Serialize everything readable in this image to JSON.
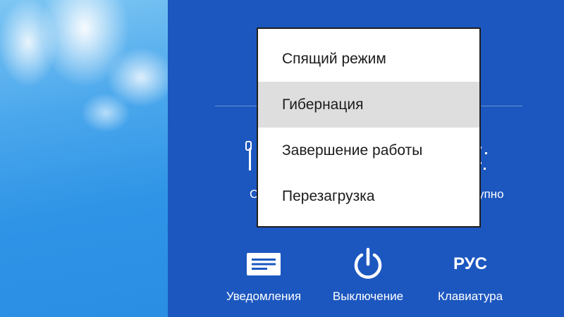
{
  "power_menu": {
    "items": [
      {
        "label": "Спящий режим"
      },
      {
        "label": "Гибернация"
      },
      {
        "label": "Завершение работы"
      },
      {
        "label": "Перезагрузка"
      }
    ]
  },
  "partial_labels": {
    "left": "С",
    "right": "упно"
  },
  "bottom_buttons": {
    "notifications": {
      "label": "Уведомления",
      "icon": "notifications-icon"
    },
    "power": {
      "label": "Выключение",
      "icon": "power-icon"
    },
    "keyboard": {
      "label": "Клавиатура",
      "lang": "РУС",
      "icon": "keyboard-language-icon"
    }
  },
  "colors": {
    "charm_background": "#1c57c0",
    "menu_background": "#ffffff",
    "menu_hover": "#dedede"
  }
}
